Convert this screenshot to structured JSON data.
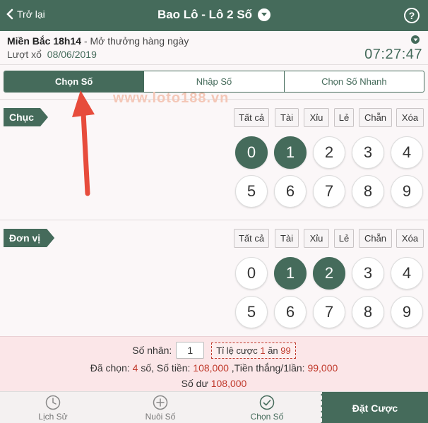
{
  "header": {
    "back_label": "Trở lại",
    "title": "Bao Lô - Lô 2 Số",
    "help_label": "?"
  },
  "draw_info": {
    "region": "Miền Bắc 18h14",
    "schedule": "- Mở thưởng hàng ngày",
    "date_label": "Lượt xổ",
    "date": "08/06/2019",
    "countdown": "07:27:47"
  },
  "tabs": [
    {
      "label": "Chọn Số",
      "active": true
    },
    {
      "label": "Nhập Số",
      "active": false
    },
    {
      "label": "Chọn Số Nhanh",
      "active": false
    }
  ],
  "watermark": "www.loto188.vn",
  "quick_buttons": [
    "Tất cả",
    "Tài",
    "Xỉu",
    "Lẻ",
    "Chẵn",
    "Xóa"
  ],
  "sections": [
    {
      "label": "Chục",
      "numbers": [
        "0",
        "1",
        "2",
        "3",
        "4",
        "5",
        "6",
        "7",
        "8",
        "9"
      ],
      "selected": [
        "0",
        "1"
      ]
    },
    {
      "label": "Đơn vị",
      "numbers": [
        "0",
        "1",
        "2",
        "3",
        "4",
        "5",
        "6",
        "7",
        "8",
        "9"
      ],
      "selected": [
        "1",
        "2"
      ]
    }
  ],
  "summary": {
    "multiplier_label": "Số nhân:",
    "multiplier_value": "1",
    "odds_prefix": "Tỉ lệ cược",
    "odds_win": "1",
    "odds_mid": "ăn",
    "odds_payout": "99",
    "selected_label": "Đã chọn:",
    "selected_count": "4",
    "selected_unit": "số, Số tiền:",
    "amount": "108,000",
    "win_label": ",Tiền thắng/1lần:",
    "win_amount": "99,000",
    "balance_label": "Số dư",
    "balance": "108,000"
  },
  "bottom_nav": {
    "history": "Lịch Sử",
    "raise": "Nuôi Số",
    "pick": "Chọn Số",
    "place_bet": "Đặt Cược"
  },
  "colors": {
    "primary": "#456b5b",
    "accent_red": "#c0392b",
    "arrow": "#e74c3c"
  }
}
